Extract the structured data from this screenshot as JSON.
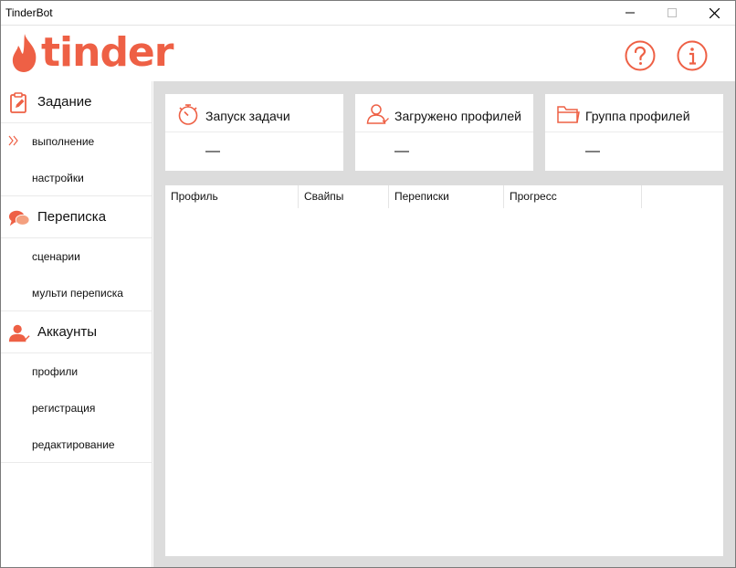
{
  "app": {
    "window_title": "TinderBot",
    "brand_text": "tinder",
    "accent_color": "#ee6045"
  },
  "header": {
    "help_icon": "question-circle-icon",
    "info_icon": "info-circle-icon"
  },
  "sidebar": {
    "sections": [
      {
        "title": "Задание",
        "icon": "clipboard-edit-icon",
        "items": [
          {
            "label": "выполнение",
            "active": true
          },
          {
            "label": "настройки",
            "active": false
          }
        ]
      },
      {
        "title": "Переписка",
        "icon": "chat-bubbles-icon",
        "items": [
          {
            "label": "сценарии",
            "active": false
          },
          {
            "label": "мульти переписка",
            "active": false
          }
        ]
      },
      {
        "title": "Аккаунты",
        "icon": "user-check-icon",
        "items": [
          {
            "label": "профили",
            "active": false
          },
          {
            "label": "регистрация",
            "active": false
          },
          {
            "label": "редактирование",
            "active": false
          }
        ]
      }
    ]
  },
  "cards": [
    {
      "title": "Запуск задачи",
      "value": "—",
      "icon": "stopwatch-icon"
    },
    {
      "title": "Загружено профилей",
      "value": "—",
      "icon": "user-outline-icon"
    },
    {
      "title": "Группа профилей",
      "value": "—",
      "icon": "folder-icon"
    }
  ],
  "table": {
    "columns": [
      "Профиль",
      "Свайпы",
      "Переписки",
      "Прогресс"
    ],
    "rows": []
  }
}
